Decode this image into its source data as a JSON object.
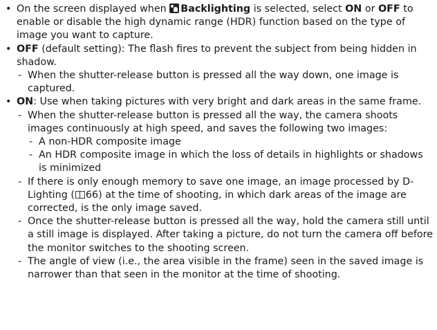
{
  "b1": {
    "t1": "On the screen displayed when",
    "icon": "backlighting-scene-icon",
    "t2": "Backlighting",
    "t3": "is selected, select",
    "t4": "ON",
    "t5": "or",
    "t6": "OFF",
    "t7": "to enable or disable the high dynamic range (HDR) function based on the type of image you want to capture."
  },
  "b2": {
    "t1": "OFF",
    "t2": "(default setting): The flash fires to prevent the subject from being hidden in shadow.",
    "s1": "When the shutter-release button is pressed all the way down, one image is captured."
  },
  "b3": {
    "t1": "ON",
    "t2": ": Use when taking pictures with very bright and dark areas in the same frame.",
    "s1": "When the shutter-release button is pressed all the way, the camera shoots images continuously at high speed, and saves the following two images:",
    "ss1": "A non-HDR composite image",
    "ss2": "An HDR composite image in which the loss of details in highlights or shadows is minimized",
    "s2a": "If there is only enough memory to save one image, an image processed by D-Lighting (",
    "ref_icon": "book-reference-icon",
    "s2b": "66) at the time of shooting, in which dark areas of the image are corrected, is the only image saved.",
    "s3": "Once the shutter-release button is pressed all the way, hold the camera still until a still image is displayed. After taking a picture, do not turn the camera off before the monitor switches to the shooting screen.",
    "s4": "The angle of view (i.e., the area visible in the frame) seen in the saved image is narrower than that seen in the monitor at the time of shooting."
  }
}
